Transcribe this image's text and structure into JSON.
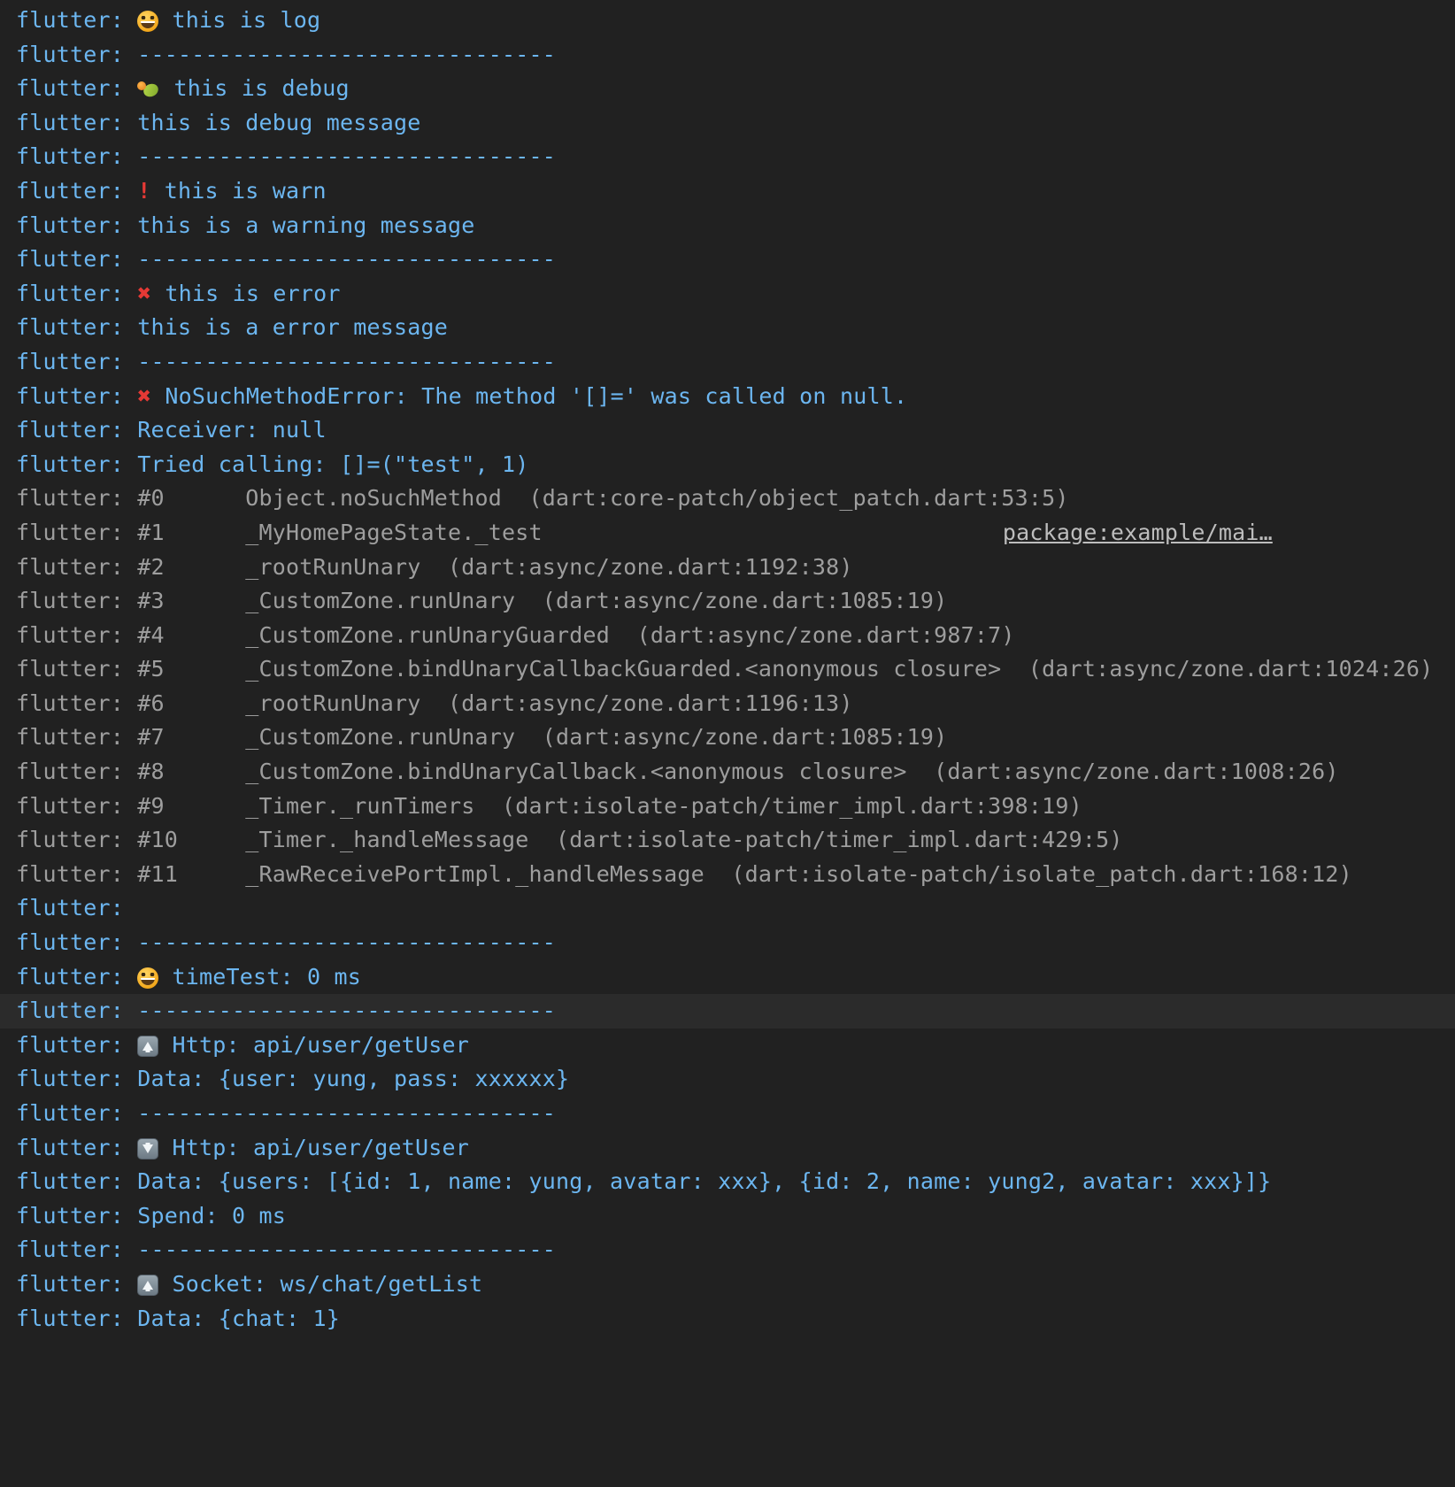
{
  "console": {
    "app_name": "flutter",
    "prefix": "flutter: ",
    "background_color": "#212121",
    "info_color": "#6cb6f0",
    "trace_color": "#9e9e9e",
    "error_color": "#e53935",
    "divider": "-------------------------------",
    "lines": [
      {
        "id": "l1",
        "kind": "info",
        "icon": "grinning-face-emoji",
        "text": " this is log"
      },
      {
        "id": "l2",
        "kind": "info",
        "icon": null,
        "text": "-------------------------------"
      },
      {
        "id": "l3",
        "kind": "info",
        "icon": "bug-emoji",
        "text": " this is debug"
      },
      {
        "id": "l4",
        "kind": "info",
        "icon": null,
        "text": "this is debug message"
      },
      {
        "id": "l5",
        "kind": "info",
        "icon": null,
        "text": "-------------------------------"
      },
      {
        "id": "l6",
        "kind": "info",
        "icon": "exclamation-mark-icon",
        "text": " this is warn"
      },
      {
        "id": "l7",
        "kind": "info",
        "icon": null,
        "text": "this is a warning message"
      },
      {
        "id": "l8",
        "kind": "info",
        "icon": null,
        "text": "-------------------------------"
      },
      {
        "id": "l9",
        "kind": "info",
        "icon": "cross-mark-icon",
        "text": " this is error"
      },
      {
        "id": "l10",
        "kind": "info",
        "icon": null,
        "text": "this is a error message"
      },
      {
        "id": "l11",
        "kind": "info",
        "icon": null,
        "text": "-------------------------------"
      },
      {
        "id": "l12",
        "kind": "info",
        "icon": "cross-mark-icon",
        "text": " NoSuchMethodError: The method '[]=' was called on null."
      },
      {
        "id": "l13",
        "kind": "info",
        "icon": null,
        "text": "Receiver: null"
      },
      {
        "id": "l14",
        "kind": "info",
        "icon": null,
        "text": "Tried calling: []=(\"test\", 1)"
      },
      {
        "id": "l15",
        "kind": "trace",
        "icon": null,
        "text": "#0      Object.noSuchMethod  (dart:core-patch/object_patch.dart:53:5)"
      },
      {
        "id": "l16",
        "kind": "trace",
        "icon": null,
        "text": "#1      _MyHomePageState._test",
        "link": "package:example/mai…"
      },
      {
        "id": "l17",
        "kind": "trace",
        "icon": null,
        "text": "#2      _rootRunUnary  (dart:async/zone.dart:1192:38)"
      },
      {
        "id": "l18",
        "kind": "trace",
        "icon": null,
        "text": "#3      _CustomZone.runUnary  (dart:async/zone.dart:1085:19)"
      },
      {
        "id": "l19",
        "kind": "trace",
        "icon": null,
        "text": "#4      _CustomZone.runUnaryGuarded  (dart:async/zone.dart:987:7)"
      },
      {
        "id": "l20",
        "kind": "trace",
        "icon": null,
        "text": "#5      _CustomZone.bindUnaryCallbackGuarded.<anonymous closure>  (dart:async/zone.dart:1024:26)"
      },
      {
        "id": "l21",
        "kind": "trace",
        "icon": null,
        "text": "#6      _rootRunUnary  (dart:async/zone.dart:1196:13)"
      },
      {
        "id": "l22",
        "kind": "trace",
        "icon": null,
        "text": "#7      _CustomZone.runUnary  (dart:async/zone.dart:1085:19)"
      },
      {
        "id": "l23",
        "kind": "trace",
        "icon": null,
        "text": "#8      _CustomZone.bindUnaryCallback.<anonymous closure>  (dart:async/zone.dart:1008:26)"
      },
      {
        "id": "l24",
        "kind": "trace",
        "icon": null,
        "text": "#9      _Timer._runTimers  (dart:isolate-patch/timer_impl.dart:398:19)"
      },
      {
        "id": "l25",
        "kind": "trace",
        "icon": null,
        "text": "#10     _Timer._handleMessage  (dart:isolate-patch/timer_impl.dart:429:5)"
      },
      {
        "id": "l26",
        "kind": "trace",
        "icon": null,
        "text": "#11     _RawReceivePortImpl._handleMessage  (dart:isolate-patch/isolate_patch.dart:168:12)"
      },
      {
        "id": "l27",
        "kind": "info",
        "icon": null,
        "text": ""
      },
      {
        "id": "l28",
        "kind": "info",
        "icon": null,
        "text": "-------------------------------"
      },
      {
        "id": "l29",
        "kind": "info",
        "icon": "grinning-face-emoji",
        "text": " timeTest: 0 ms"
      },
      {
        "id": "l30",
        "kind": "info",
        "icon": null,
        "text": "-------------------------------",
        "highlighted": true
      },
      {
        "id": "l31",
        "kind": "info",
        "icon": "up-arrow-icon",
        "text": " Http: api/user/getUser"
      },
      {
        "id": "l32",
        "kind": "info",
        "icon": null,
        "text": "Data: {user: yung, pass: xxxxxx}"
      },
      {
        "id": "l33",
        "kind": "info",
        "icon": null,
        "text": "-------------------------------"
      },
      {
        "id": "l34",
        "kind": "info",
        "icon": "down-arrow-icon",
        "text": " Http: api/user/getUser"
      },
      {
        "id": "l35",
        "kind": "info",
        "icon": null,
        "text": "Data: {users: [{id: 1, name: yung, avatar: xxx}, {id: 2, name: yung2, avatar: xxx}]}"
      },
      {
        "id": "l36",
        "kind": "info",
        "icon": null,
        "text": "Spend: 0 ms"
      },
      {
        "id": "l37",
        "kind": "info",
        "icon": null,
        "text": "-------------------------------"
      },
      {
        "id": "l38",
        "kind": "info",
        "icon": "up-arrow-icon",
        "text": " Socket: ws/chat/getList"
      },
      {
        "id": "l39",
        "kind": "info",
        "icon": null,
        "text": "Data: {chat: 1}"
      }
    ]
  }
}
